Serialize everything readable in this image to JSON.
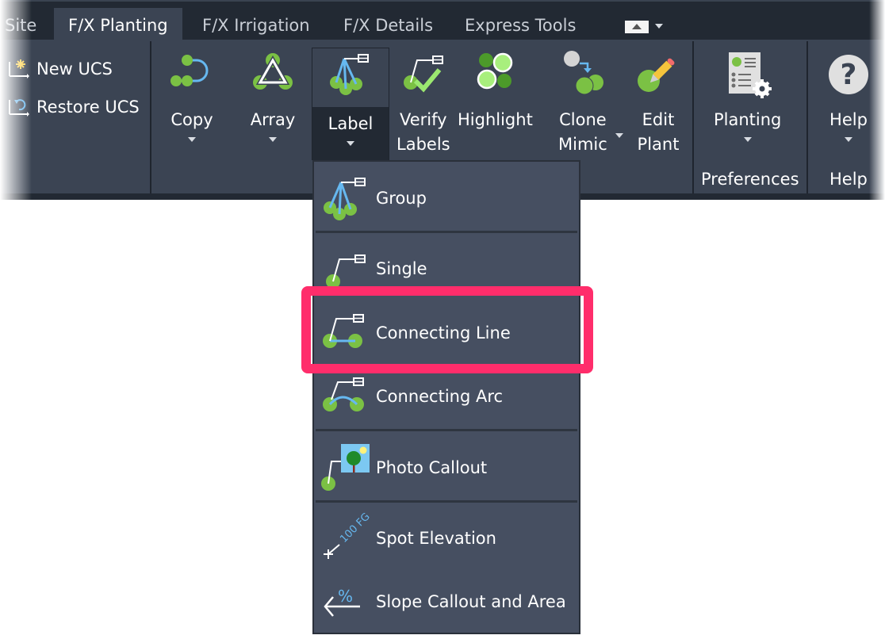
{
  "tabs": [
    {
      "label": "Site",
      "active": false
    },
    {
      "label": "F/X Planting",
      "active": true
    },
    {
      "label": "F/X Irrigation",
      "active": false
    },
    {
      "label": "F/X Details",
      "active": false
    },
    {
      "label": "Express Tools",
      "active": false
    }
  ],
  "ucs": {
    "new_label": "New UCS",
    "restore_label": "Restore UCS"
  },
  "buttons": {
    "copy": "Copy",
    "array": "Array",
    "label": "Label",
    "verify_1": "Verify",
    "verify_2": "Labels",
    "highlight": "Highlight",
    "clone_1": "Clone",
    "clone_2": "Mimic",
    "edit_1": "Edit",
    "edit_2": "Plant",
    "planting": "Planting",
    "help": "Help"
  },
  "groups": {
    "preferences": "Preferences",
    "help": "Help"
  },
  "label_menu": {
    "items": [
      {
        "label": "Group",
        "icon": "group-label-icon"
      },
      {
        "label": "Single",
        "icon": "single-label-icon"
      },
      {
        "label": "Connecting Line",
        "icon": "connecting-line-icon",
        "highlighted": true
      },
      {
        "label": "Connecting Arc",
        "icon": "connecting-arc-icon"
      },
      {
        "label": "Photo Callout",
        "icon": "photo-callout-icon"
      },
      {
        "label": "Spot Elevation",
        "icon": "spot-elevation-icon",
        "icon_text": "100 FG"
      },
      {
        "label": "Slope Callout and Area",
        "icon": "slope-callout-icon",
        "icon_text": "%"
      }
    ]
  },
  "colors": {
    "ribbon_bg": "#3b4453",
    "tabbar_bg": "#222933",
    "menu_bg": "#464f61",
    "plant_green": "#7bc144",
    "leader_blue": "#66b8f0",
    "highlight_border": "#ff2d6b"
  }
}
